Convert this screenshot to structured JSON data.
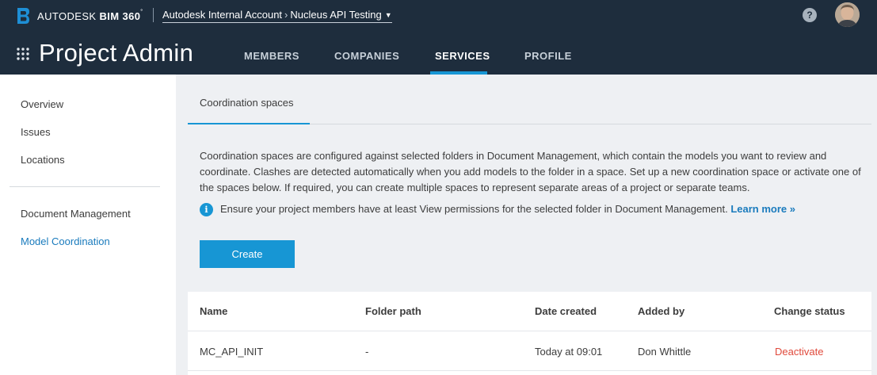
{
  "topbar": {
    "brand_name": "AUTODESK",
    "brand_product": "BIM 360",
    "brand_tm": "˚",
    "account": "Autodesk Internal Account",
    "breadcrumb_sep": "›",
    "project": "Nucleus API Testing",
    "help_label": "?"
  },
  "header": {
    "title": "Project Admin",
    "tabs": [
      {
        "label": "MEMBERS"
      },
      {
        "label": "COMPANIES"
      },
      {
        "label": "SERVICES",
        "active": true
      },
      {
        "label": "PROFILE"
      }
    ]
  },
  "sidebar": {
    "items": [
      {
        "label": "Overview"
      },
      {
        "label": "Issues"
      },
      {
        "label": "Locations"
      },
      {
        "label": "Document Management"
      },
      {
        "label": "Model Coordination",
        "active": true
      }
    ]
  },
  "main": {
    "tab": "Coordination spaces",
    "description": "Coordination spaces are configured against selected folders in Document Management, which contain the models you want to review and coordinate. Clashes are detected automatically when you add models to the folder in a space. Set up a new coordination space or activate one of the spaces below. If required, you can create multiple spaces to represent separate areas of a project or separate teams.",
    "info": "Ensure your project members have at least View permissions for the selected folder in Document Management.",
    "learn_more": "Learn more »",
    "create_label": "Create"
  },
  "table": {
    "columns": [
      "Name",
      "Folder path",
      "Date created",
      "Added by",
      "Change status"
    ],
    "rows": [
      {
        "name": "MC_API_INIT",
        "folder_path": "-",
        "date_created": "Today at 09:01",
        "added_by": "Don Whittle",
        "status_action": "Deactivate"
      }
    ]
  },
  "colors": {
    "header_bg": "#1e2d3d",
    "accent": "#1796d4",
    "link": "#1a7bbd",
    "danger": "#e0493b"
  },
  "icons": {
    "brand": "bim360-logo-icon",
    "help": "help-icon",
    "apps": "apps-grid-icon",
    "info": "info-icon"
  }
}
